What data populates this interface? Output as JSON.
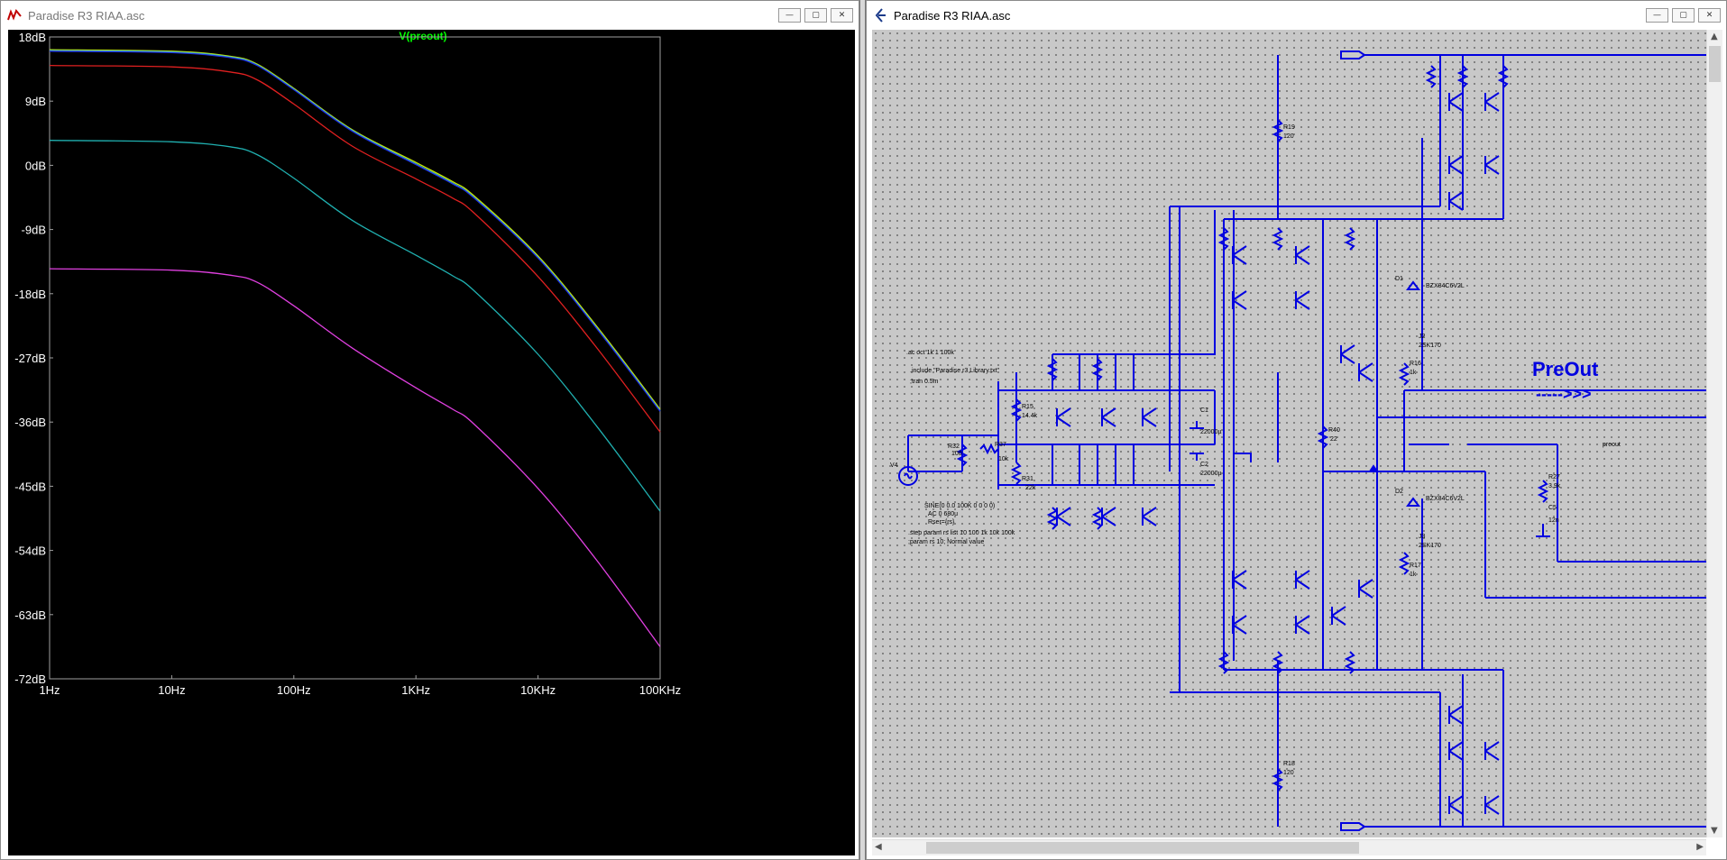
{
  "plot_window": {
    "title": "Paradise R3 RIAA.asc",
    "trace_label": "V(preout)",
    "buttons": {
      "minimize": "—",
      "maximize": "▢",
      "close": "✕"
    }
  },
  "schematic_window": {
    "title": "Paradise R3 RIAA.asc",
    "buttons": {
      "minimize": "—",
      "maximize": "▢",
      "close": "✕"
    },
    "directives": [
      ".ac oct 1k 1 100k",
      ".include \"Paradise r3 Library.txt\"",
      ";tran 0.5m"
    ],
    "source_lines": [
      "SINE(0 0.0 100K 0 0 0 0)",
      "AC 0 680u",
      "Rser={rs}"
    ],
    "param_lines": [
      ".step param rs list 10 100 1k 10k 100k",
      ";param rs 10; Normal value"
    ],
    "net_label": "PreOut",
    "net_arrow": "----->>>",
    "preout_label": "preout",
    "components": {
      "source": {
        "name": "V4"
      },
      "r32": {
        "name": "R32",
        "value": "100"
      },
      "r37": {
        "name": "R37",
        "value": "10k"
      },
      "r15": {
        "name": "R15",
        "value": "14.4k"
      },
      "r31": {
        "name": "R31",
        "value": "22k"
      },
      "c1": {
        "name": "C1",
        "value": "22000µ"
      },
      "c2": {
        "name": "C2",
        "value": "22000µ"
      },
      "r40": {
        "name": "R40",
        "value": "22"
      },
      "r27": {
        "name": "R27",
        "value": "3.9k"
      },
      "c5": {
        "name": "C5",
        "value": "12n"
      },
      "r19": {
        "name": "R19",
        "value": "120"
      },
      "r18": {
        "name": "R18",
        "value": "120"
      },
      "r16": {
        "name": "R16",
        "value": "1k"
      },
      "r17": {
        "name": "R17",
        "value": "1k"
      },
      "d1": {
        "name": "D1",
        "model": "BZX84C6V2L"
      },
      "d2": {
        "name": "D2",
        "model": "BZX84C6V2L"
      },
      "j2": {
        "name": "J2",
        "model": "2SK170"
      },
      "j3": {
        "name": "J3",
        "model": "2SK170"
      }
    }
  },
  "chart_data": {
    "type": "line",
    "title": "V(preout)",
    "xlabel": "",
    "ylabel": "",
    "x_scale": "log",
    "xlim": [
      1,
      100000
    ],
    "ylim": [
      -72,
      18
    ],
    "grid": false,
    "x_ticks": [
      1,
      10,
      100,
      1000,
      10000,
      100000
    ],
    "x_tick_labels": [
      "1Hz",
      "10Hz",
      "100Hz",
      "1KHz",
      "10KHz",
      "100KHz"
    ],
    "y_ticks": [
      18,
      9,
      0,
      -9,
      -18,
      -27,
      -36,
      -45,
      -54,
      -63,
      -72
    ],
    "y_tick_labels": [
      "18dB",
      "9dB",
      "0dB",
      "-9dB",
      "-18dB",
      "-27dB",
      "-36dB",
      "-45dB",
      "-54dB",
      "-63dB",
      "-72dB"
    ],
    "x": [
      1,
      10,
      30,
      50,
      100,
      300,
      1000,
      2000,
      3000,
      10000,
      30000,
      100000
    ],
    "series": [
      {
        "color": "#c8e600",
        "values": [
          16.2,
          16.0,
          15.3,
          14.2,
          10.8,
          5.0,
          0.4,
          -2.3,
          -4.3,
          -12.7,
          -22.5,
          -34.2
        ]
      },
      {
        "color": "#40c0c0",
        "values": [
          16.1,
          15.9,
          15.2,
          14.1,
          10.7,
          4.9,
          0.2,
          -2.5,
          -4.5,
          -12.9,
          -22.7,
          -34.4
        ]
      },
      {
        "color": "#2030e0",
        "values": [
          16.0,
          15.8,
          15.1,
          14.0,
          10.6,
          4.8,
          0.1,
          -2.6,
          -4.6,
          -13.0,
          -22.8,
          -34.5
        ]
      },
      {
        "color": "#e02020",
        "values": [
          14.0,
          13.8,
          13.1,
          12.0,
          8.6,
          2.7,
          -1.9,
          -4.6,
          -6.7,
          -15.6,
          -25.5,
          -37.4
        ]
      },
      {
        "color": "#20b0b0",
        "values": [
          3.5,
          3.3,
          2.6,
          1.5,
          -1.8,
          -7.7,
          -12.6,
          -15.5,
          -17.6,
          -26.5,
          -36.5,
          -48.5
        ]
      },
      {
        "color": "#e040e0",
        "values": [
          -14.5,
          -14.7,
          -15.4,
          -16.4,
          -19.7,
          -25.6,
          -31.2,
          -34.2,
          -36.3,
          -45.3,
          -55.3,
          -67.5
        ]
      }
    ]
  }
}
